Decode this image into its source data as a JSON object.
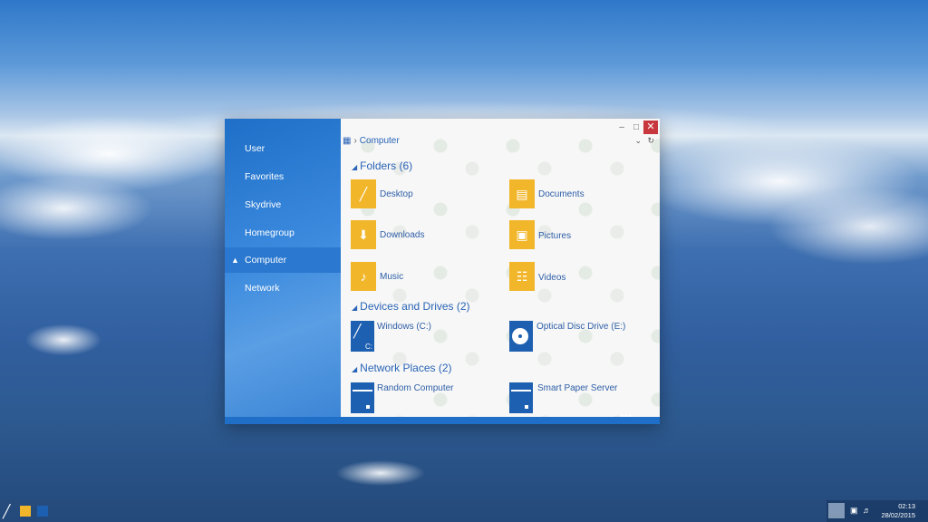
{
  "sidebar": {
    "items": [
      {
        "label": "User",
        "active": false
      },
      {
        "label": "Favorites",
        "active": false
      },
      {
        "label": "Skydrive",
        "active": false
      },
      {
        "label": "Homegroup",
        "active": false
      },
      {
        "label": "Computer",
        "active": true
      },
      {
        "label": "Network",
        "active": false
      }
    ]
  },
  "address": {
    "location": "Computer"
  },
  "sections": {
    "folders": "Folders (6)",
    "devices": "Devices and Drives (2)",
    "network": "Network Places (2)"
  },
  "folders": [
    {
      "label": "Desktop",
      "icon": "desktop-icon"
    },
    {
      "label": "Documents",
      "icon": "documents-icon"
    },
    {
      "label": "Downloads",
      "icon": "downloads-icon"
    },
    {
      "label": "Pictures",
      "icon": "pictures-icon"
    },
    {
      "label": "Music",
      "icon": "music-icon"
    },
    {
      "label": "Videos",
      "icon": "videos-icon"
    }
  ],
  "drives": [
    {
      "label": "Windows (C:)",
      "icon": "windows-drive-icon",
      "letter": "C:"
    },
    {
      "label": "Optical Disc Drive (E:)",
      "icon": "optical-drive-icon"
    }
  ],
  "network_places": [
    {
      "label": "Random Computer",
      "icon": "server-icon"
    },
    {
      "label": "Smart Paper Server",
      "icon": "server-icon"
    }
  ],
  "taskbar": {
    "time": "02:13",
    "date": "28/02/2015"
  },
  "colors": {
    "accent": "#1f6fc8",
    "folder": "#f2b62a",
    "close": "#c8373d"
  }
}
